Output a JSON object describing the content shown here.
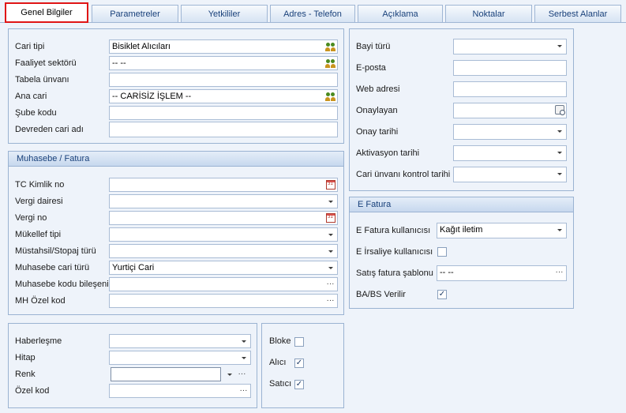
{
  "tabs": [
    {
      "label": "Genel Bilgiler",
      "active": true
    },
    {
      "label": "Parametreler"
    },
    {
      "label": "Yetkililer"
    },
    {
      "label": "Adres - Telefon"
    },
    {
      "label": "Açıklama"
    },
    {
      "label": "Noktalar"
    },
    {
      "label": "Serbest Alanlar"
    }
  ],
  "general": {
    "cari_tipi": {
      "label": "Cari tipi",
      "value": "Bisiklet Alıcıları"
    },
    "faaliyet": {
      "label": "Faaliyet sektörü",
      "value": "-- --"
    },
    "tabela": {
      "label": "Tabela ünvanı",
      "value": ""
    },
    "ana_cari": {
      "label": "Ana cari",
      "value": "-- CARİSİZ İŞLEM --"
    },
    "sube": {
      "label": "Şube kodu",
      "value": ""
    },
    "devreden": {
      "label": "Devreden cari adı",
      "value": ""
    }
  },
  "muhasebe": {
    "title": "Muhasebe / Fatura",
    "tc": {
      "label": "TC Kimlik no",
      "value": ""
    },
    "vergi_dairesi": {
      "label": "Vergi dairesi",
      "value": ""
    },
    "vergi_no": {
      "label": "Vergi no",
      "value": ""
    },
    "mukellef": {
      "label": "Mükellef tipi",
      "value": ""
    },
    "mustahsil": {
      "label": "Müstahsil/Stopaj türü",
      "value": ""
    },
    "cari_turu": {
      "label": "Muhasebe cari türü",
      "value": "Yurtiçi Cari"
    },
    "kodu": {
      "label": "Muhasebe kodu bileşeni",
      "value": ""
    },
    "mh_ozel": {
      "label": "MH Özel kod",
      "value": ""
    }
  },
  "misc": {
    "haberlesme": {
      "label": "Haberleşme",
      "value": ""
    },
    "hitap": {
      "label": "Hitap",
      "value": ""
    },
    "renk": {
      "label": "Renk",
      "value": ""
    },
    "ozel_kod": {
      "label": "Özel kod",
      "value": ""
    }
  },
  "flags": {
    "bloke": {
      "label": "Bloke",
      "checked": false
    },
    "alici": {
      "label": "Alıcı",
      "checked": true
    },
    "satici": {
      "label": "Satıcı",
      "checked": true
    }
  },
  "right": {
    "bayi": {
      "label": "Bayi türü",
      "value": ""
    },
    "eposta": {
      "label": "E-posta",
      "value": ""
    },
    "web": {
      "label": "Web adresi",
      "value": ""
    },
    "onaylayan": {
      "label": "Onaylayan",
      "value": ""
    },
    "onay_tarihi": {
      "label": "Onay tarihi",
      "value": ""
    },
    "aktivasyon": {
      "label": "Aktivasyon tarihi",
      "value": ""
    },
    "kontrol": {
      "label": "Cari ünvanı kontrol tarihi",
      "value": ""
    }
  },
  "efatura": {
    "title": "E Fatura",
    "kullanici": {
      "label": "E Fatura kullanıcısı",
      "value": "Kağıt iletim"
    },
    "irsaliye": {
      "label": "E İrsaliye kullanıcısı",
      "checked": false
    },
    "sablon": {
      "label": "Satış fatura şablonu",
      "value": "-- --"
    },
    "babs": {
      "label": "BA/BS Verilir",
      "checked": true
    }
  },
  "calendar_glyph": "31",
  "check_glyph": "✓"
}
